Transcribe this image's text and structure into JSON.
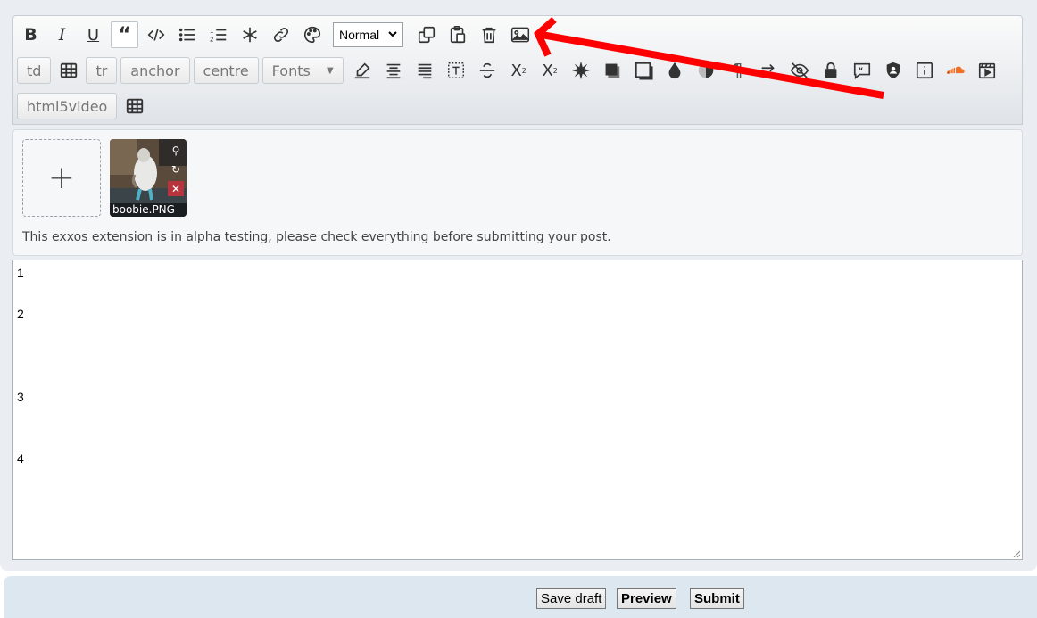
{
  "toolbar": {
    "format_select_value": "Normal",
    "row2": {
      "td": "td",
      "tr": "tr",
      "anchor": "anchor",
      "centre": "centre",
      "fonts": "Fonts"
    },
    "row3": {
      "html5video": "html5video"
    }
  },
  "attachments": {
    "add_symbol": "+",
    "items": [
      {
        "filename": "boobie.PNG"
      }
    ],
    "notice": "This exxos extension is in alpha testing, please check everything before submitting your post."
  },
  "editor": {
    "lines": [
      "1",
      "2",
      "3",
      "4"
    ]
  },
  "buttons": {
    "save_draft": "Save draft",
    "preview": "Preview",
    "submit": "Submit"
  },
  "colors": {
    "annotation_arrow": "#ff0000",
    "toolbar_bg": "#e3e7eb",
    "bottom_bar": "#dde7ef"
  }
}
